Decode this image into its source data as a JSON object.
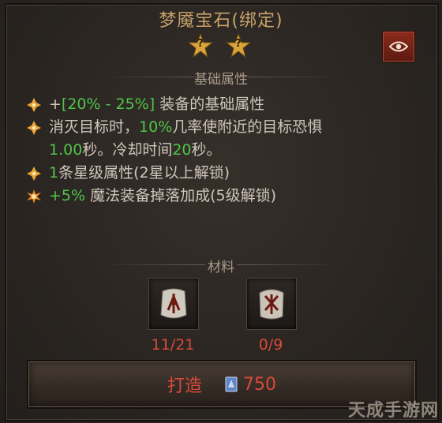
{
  "item": {
    "title": "梦魇宝石(绑定)",
    "star_glyph": "?",
    "star_count": 2
  },
  "sections": {
    "base_stats": "基础属性",
    "materials": "材料"
  },
  "attributes": [
    {
      "segments": [
        {
          "text": "+",
          "color": "normal"
        },
        {
          "text": "[20% - 25%]",
          "color": "green"
        },
        {
          "text": " 装备的基础属性",
          "color": "normal"
        }
      ],
      "bullet": "diamond"
    },
    {
      "segments": [
        {
          "text": "消灭目标时，",
          "color": "normal"
        },
        {
          "text": "10%",
          "color": "green"
        },
        {
          "text": "几率使附近的目标恐惧",
          "color": "normal"
        }
      ],
      "bullet": "diamond"
    },
    {
      "segments": [
        {
          "text": "1.00",
          "color": "green"
        },
        {
          "text": "秒。冷却时间",
          "color": "normal"
        },
        {
          "text": "20",
          "color": "green"
        },
        {
          "text": "秒。",
          "color": "normal"
        }
      ],
      "bullet": "none"
    },
    {
      "segments": [
        {
          "text": "1",
          "color": "green"
        },
        {
          "text": "条星级属性(2星以上解锁)",
          "color": "normal"
        }
      ],
      "bullet": "diamond"
    },
    {
      "segments": [
        {
          "text": "+5%",
          "color": "green"
        },
        {
          "text": " 魔法装备掉落加成(5级解锁)",
          "color": "normal"
        }
      ],
      "bullet": "burst"
    }
  ],
  "materials": [
    {
      "name": "rune-ahn",
      "count": "11/21"
    },
    {
      "name": "rune-yax",
      "count": "0/9"
    }
  ],
  "craft": {
    "label": "打造",
    "cost": "750",
    "currency_icon": "shard-icon"
  },
  "watermark": "天成手游网",
  "colors": {
    "title": "#c9a36a",
    "green": "#4fc54a",
    "insufficient": "#d84a3a",
    "text": "#cfc6bb",
    "eye_button": "#8a2a1c"
  }
}
